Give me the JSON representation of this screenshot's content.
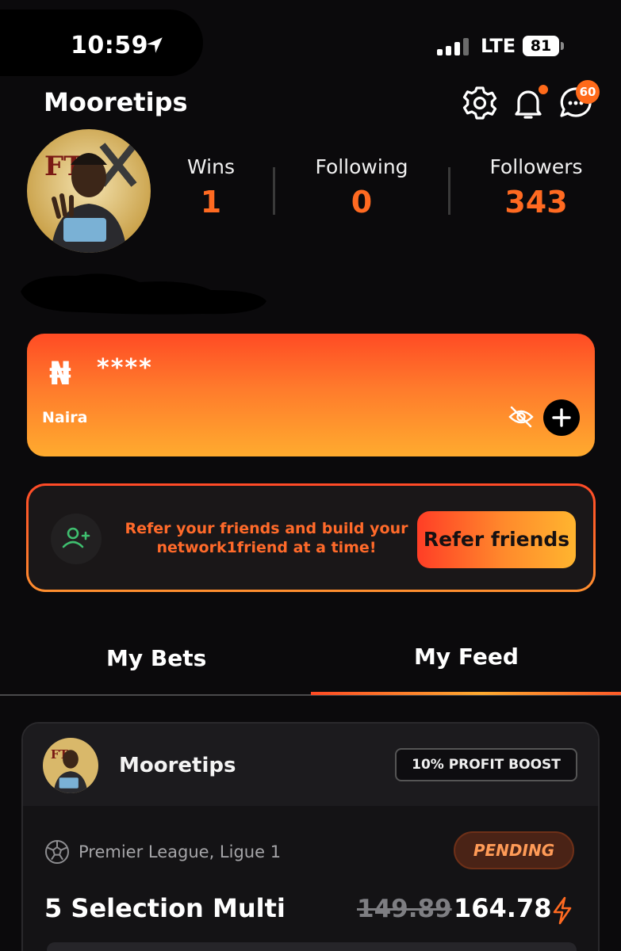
{
  "status_bar": {
    "time": "10:59",
    "network": "LTE",
    "battery": "81",
    "icons": [
      "location-arrow-icon",
      "signal-icon",
      "battery-icon"
    ]
  },
  "header": {
    "username": "Mooretips",
    "icons": [
      "gear-icon",
      "bell-icon",
      "chat-icon"
    ],
    "message_badge": "60"
  },
  "stats": [
    {
      "label": "Wins",
      "value": "1"
    },
    {
      "label": "Following",
      "value": "0"
    },
    {
      "label": "Followers",
      "value": "343"
    }
  ],
  "wallet": {
    "currency_symbol": "₦",
    "balance_masked": "****",
    "currency_name": "Naira",
    "icons": [
      "eye-off-icon",
      "plus-icon"
    ]
  },
  "referral": {
    "text": "Refer your friends and build your network1friend at a time!",
    "button_label": "Refer friends",
    "icon": "add-user-icon"
  },
  "tabs": {
    "items": [
      "My Bets",
      "My Feed"
    ],
    "active": "My Feed"
  },
  "bet": {
    "username": "Mooretips",
    "boost_label": "10% PROFIT BOOST",
    "leagues": "Premier League, Ligue 1",
    "status": "PENDING",
    "title": "5 Selection Multi",
    "old_odds": "149.89",
    "new_odds": "164.78",
    "icons": [
      "soccer-ball-icon",
      "lightning-bolt-icon"
    ]
  },
  "colors": {
    "accent": "#ff6a21",
    "background": "#0b0a0c",
    "card": "#141315",
    "pending_text": "#ff9b57"
  }
}
